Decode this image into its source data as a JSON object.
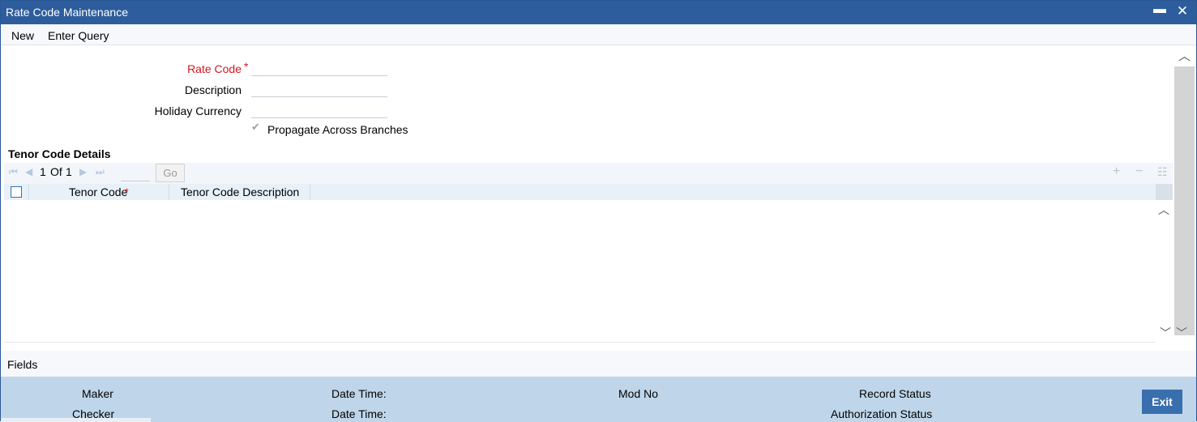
{
  "window": {
    "title": "Rate Code Maintenance",
    "minimize_glyph": "▬",
    "close_glyph": "✕"
  },
  "menu": {
    "items": [
      "New",
      "Enter Query"
    ]
  },
  "form": {
    "rate_code_label": "Rate Code",
    "rate_code_required": "*",
    "rate_code_value": "",
    "description_label": "Description",
    "description_value": "",
    "holiday_currency_label": "Holiday Currency",
    "holiday_currency_value": "",
    "propagate_label": "Propagate Across Branches",
    "propagate_checked": true
  },
  "tenor": {
    "section_title": "Tenor Code Details",
    "pagination": {
      "current": "1",
      "of_label": "Of",
      "total": "1"
    },
    "go_label": "Go",
    "columns": [
      {
        "label": "Tenor Code",
        "required": "*"
      },
      {
        "label": "Tenor Code Description"
      }
    ],
    "rows": []
  },
  "fields_bar": {
    "label": "Fields"
  },
  "audit": {
    "maker_label": "Maker",
    "checker_label": "Checker",
    "date_time_label": "Date Time:",
    "mod_no_label": "Mod No",
    "record_status_label": "Record Status",
    "authorization_status_label": "Authorization Status",
    "exit_label": "Exit"
  },
  "colors": {
    "title_bar": "#2d5d9c",
    "required": "#d4161e",
    "footer": "#bfd6ea",
    "exit_button": "#3a6fae"
  }
}
